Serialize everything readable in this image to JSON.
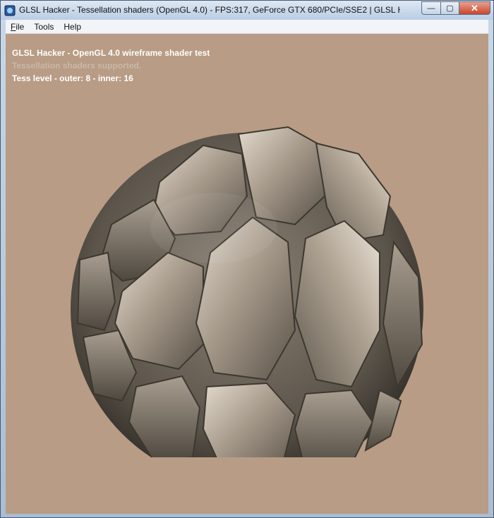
{
  "window": {
    "title": "GLSL Hacker - Tessellation shaders (OpenGL 4.0) - FPS:317, GeForce GTX 680/PCIe/SSE2 | GLSL Hacker (beta) (Win...",
    "controls": {
      "minimize": "—",
      "maximize": "▢",
      "close": "✕"
    }
  },
  "menu": {
    "items": [
      {
        "key": "F",
        "rest": "ile"
      },
      {
        "key": "",
        "rest": "Tools"
      },
      {
        "key": "",
        "rest": "Help"
      }
    ]
  },
  "hud": {
    "line1": "GLSL Hacker - OpenGL 4.0 wireframe shader test",
    "line2": "Tessellation shaders supported.",
    "line3": "Tess level - outer: 8 - inner: 16"
  },
  "colors": {
    "background": "#b89c85",
    "ball_base": "#9a8e80",
    "ball_highlight": "#e9e1d5",
    "ball_shadow": "#3e3932"
  },
  "icons": {
    "app": "glsl-hacker-app-icon"
  }
}
